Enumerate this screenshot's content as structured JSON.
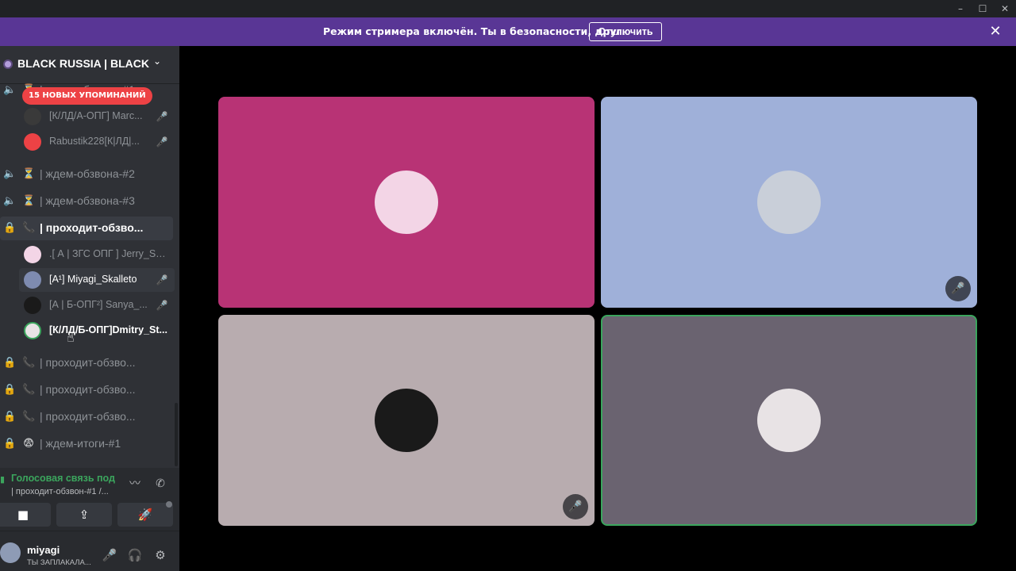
{
  "window": {
    "minimize": "–",
    "maximize": "☐",
    "close": "✕"
  },
  "banner": {
    "text": "Режим стримера включён. Ты в безопасности, друг.",
    "button": "Отключить",
    "close": "✕"
  },
  "server": {
    "name": "BLACK RUSSIA | BLACK",
    "chevron": "⌄"
  },
  "mentions_badge": "15 НОВЫХ УПОМИНАНИЙ",
  "channels": [
    {
      "icon": "speaker-icon",
      "emoji": "⏳",
      "label": "| ждем-обзвона-#1"
    },
    {
      "icon": "speaker-icon",
      "emoji": "⏳",
      "label": "| ждем-обзвона-#2"
    },
    {
      "icon": "speaker-icon",
      "emoji": "⏳",
      "label": "| ждем-обзвона-#3"
    },
    {
      "icon": "lock-icon",
      "emoji": "📞",
      "label": "| проходит-обзво..."
    },
    {
      "icon": "lock-icon",
      "emoji": "📞",
      "label": "| проходит-обзво..."
    },
    {
      "icon": "lock-icon",
      "emoji": "📞",
      "label": "| проходит-обзво..."
    },
    {
      "icon": "lock-icon",
      "emoji": "📞",
      "label": "| проходит-обзво..."
    },
    {
      "icon": "lock-icon",
      "emoji": "😨",
      "label": "| ждем-итоги-#1"
    }
  ],
  "members_top": [
    {
      "name": "[К/ЛД/А-ОПГ] Marc...",
      "muted": "🎤"
    },
    {
      "name": "Rabustik228[К|ЛД|...",
      "muted": "🎤"
    }
  ],
  "members_active": [
    {
      "name": ".[ А | ЗГС ОПГ ] Jerry_Sto..."
    },
    {
      "name": "[А¹] Miyagi_Skalleto",
      "muted": "🎤"
    },
    {
      "name": "[А | Б-ОПГ²] Sanya_...",
      "muted": "🎤"
    },
    {
      "name": "[К/ЛД/Б-ОПГ]Dmitry_St..."
    }
  ],
  "voice_panel": {
    "status": "Голосовая связь под",
    "channel": "| проходит-обзвон-#1 /...",
    "noise_icon": "〰",
    "disconnect_icon": "✆",
    "video_icon": "■",
    "screen_icon": "⇪",
    "activity_icon": "🚀"
  },
  "user": {
    "name": "miyagi",
    "status": "ТЫ ЗАПЛАКАЛА...",
    "mic_icon": "🎤",
    "headphones_icon": "🎧",
    "settings_icon": "⚙"
  },
  "tiles": [
    {
      "bg": "#b83375",
      "avatar_bg": "#f3d5e6",
      "muted": false
    },
    {
      "bg": "#9fb0d9",
      "avatar_bg": "#c9cfd9",
      "muted": true,
      "mute_icon": "🎤"
    },
    {
      "bg": "#b8acaf",
      "avatar_bg": "#1a1a1a",
      "muted": true,
      "mute_icon": "🎤"
    },
    {
      "bg": "#6a6370",
      "avatar_bg": "#e8e3e5",
      "muted": false,
      "speaking": true
    }
  ],
  "colors": {
    "accent_banner": "#593695",
    "speaking": "#3ba55d",
    "mention": "#ed4245"
  }
}
